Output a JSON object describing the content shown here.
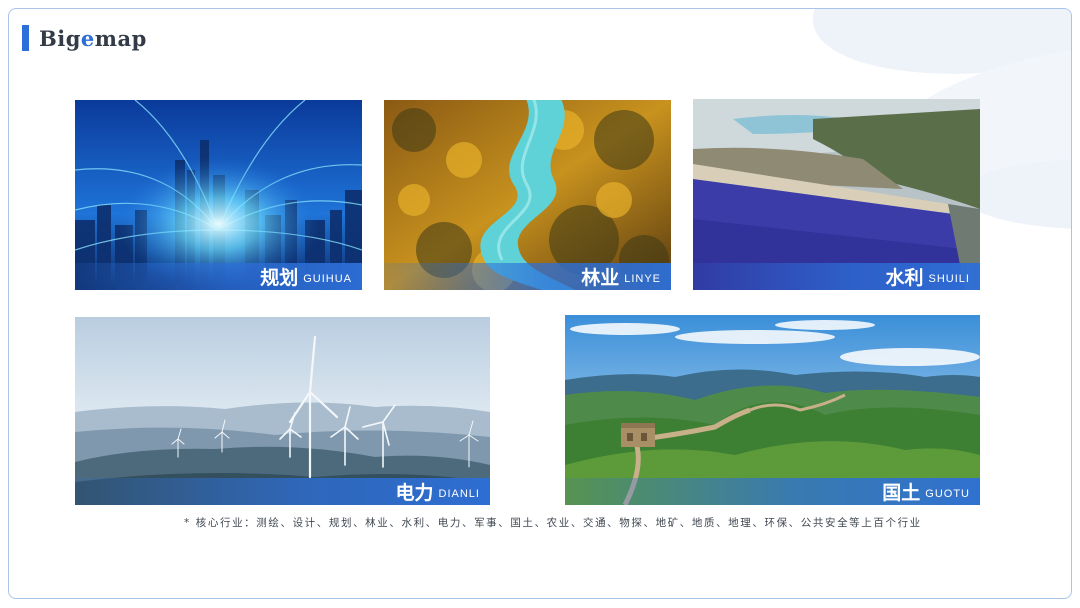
{
  "brand": {
    "prefix": "Big",
    "accent": "e",
    "suffix": "map",
    "accent_color": "#2d6fd8"
  },
  "cards": [
    {
      "cn": "规划",
      "en": "GUIHUA",
      "scene": "smart-city-skyline"
    },
    {
      "cn": "林业",
      "en": "LINYE",
      "scene": "forest-river"
    },
    {
      "cn": "水利",
      "en": "SHUILI",
      "scene": "reservoir-dam"
    },
    {
      "cn": "电力",
      "en": "DIANLI",
      "scene": "wind-turbines"
    },
    {
      "cn": "国土",
      "en": "GUOTU",
      "scene": "great-wall-mountains"
    }
  ],
  "footnote": "* 核心行业：测绘、设计、规划、林业、水利、电力、军事、国土、农业、交通、物探、地矿、地质、地理、环保、公共安全等上百个行业"
}
